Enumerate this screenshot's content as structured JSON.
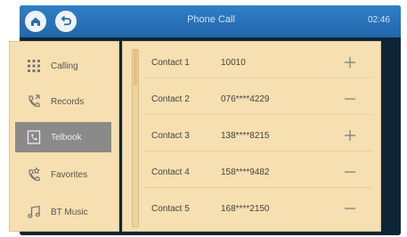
{
  "header": {
    "title": "Phone Call",
    "time": "02:46"
  },
  "sidebar": {
    "items": [
      {
        "label": "Calling",
        "icon": "keypad-icon",
        "active": false
      },
      {
        "label": "Records",
        "icon": "call-records-icon",
        "active": false
      },
      {
        "label": "Telbook",
        "icon": "phonebook-icon",
        "active": true
      },
      {
        "label": "Favorites",
        "icon": "favorites-icon",
        "active": false
      },
      {
        "label": "BT Music",
        "icon": "music-note-icon",
        "active": false
      }
    ]
  },
  "contacts": {
    "rows": [
      {
        "name": "Contact 1",
        "number": "10010",
        "action": "add"
      },
      {
        "name": "Contact 2",
        "number": "076****4229",
        "action": "remove"
      },
      {
        "name": "Contact 3",
        "number": "138****8215",
        "action": "add"
      },
      {
        "name": "Contact 4",
        "number": "158****9482",
        "action": "remove"
      },
      {
        "name": "Contact 5",
        "number": "168****2150",
        "action": "remove"
      }
    ]
  },
  "colors": {
    "topbar": "#2f7fc6",
    "panel": "#f6dfb0",
    "active_item": "#8a8a8a",
    "background": "#0d2536"
  }
}
